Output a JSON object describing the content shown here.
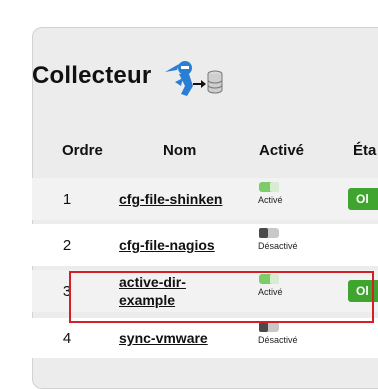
{
  "panel": {
    "title": "Collecteur",
    "logo_icon": "ninja-to-database-icon"
  },
  "table": {
    "headers": {
      "ordre": "Ordre",
      "nom": "Nom",
      "active": "Activé",
      "etat": "Éta"
    },
    "rows": [
      {
        "ordre": "1",
        "nom": "cfg-file-shinken",
        "enabled": true,
        "toggle_label": "Activé",
        "badge": "Ol"
      },
      {
        "ordre": "2",
        "nom": "cfg-file-nagios",
        "enabled": false,
        "toggle_label": "Désactivé",
        "badge": ""
      },
      {
        "ordre": "3",
        "nom": "active-dir-example",
        "enabled": true,
        "toggle_label": "Activé",
        "badge": "Ol"
      },
      {
        "ordre": "4",
        "nom": "sync-vmware",
        "enabled": false,
        "toggle_label": "Désactivé",
        "badge": ""
      }
    ]
  },
  "colors": {
    "on": "#7dcc6a",
    "badge": "#3fa52e",
    "highlight": "#d32027"
  }
}
